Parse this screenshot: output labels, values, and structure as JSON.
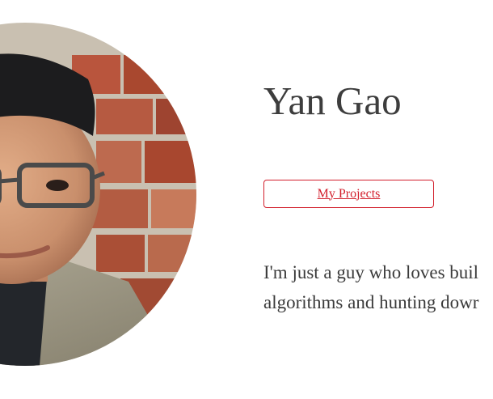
{
  "profile": {
    "name": "Yan Gao",
    "projects_label": "My Projects",
    "bio_lines": [
      "I'm just a guy who loves buil",
      "algorithms and hunting dowr"
    ]
  },
  "colors": {
    "accent": "#d21f2c",
    "heading": "#3d3d3d",
    "body_text": "#3a3a3a",
    "background": "#ffffff"
  }
}
